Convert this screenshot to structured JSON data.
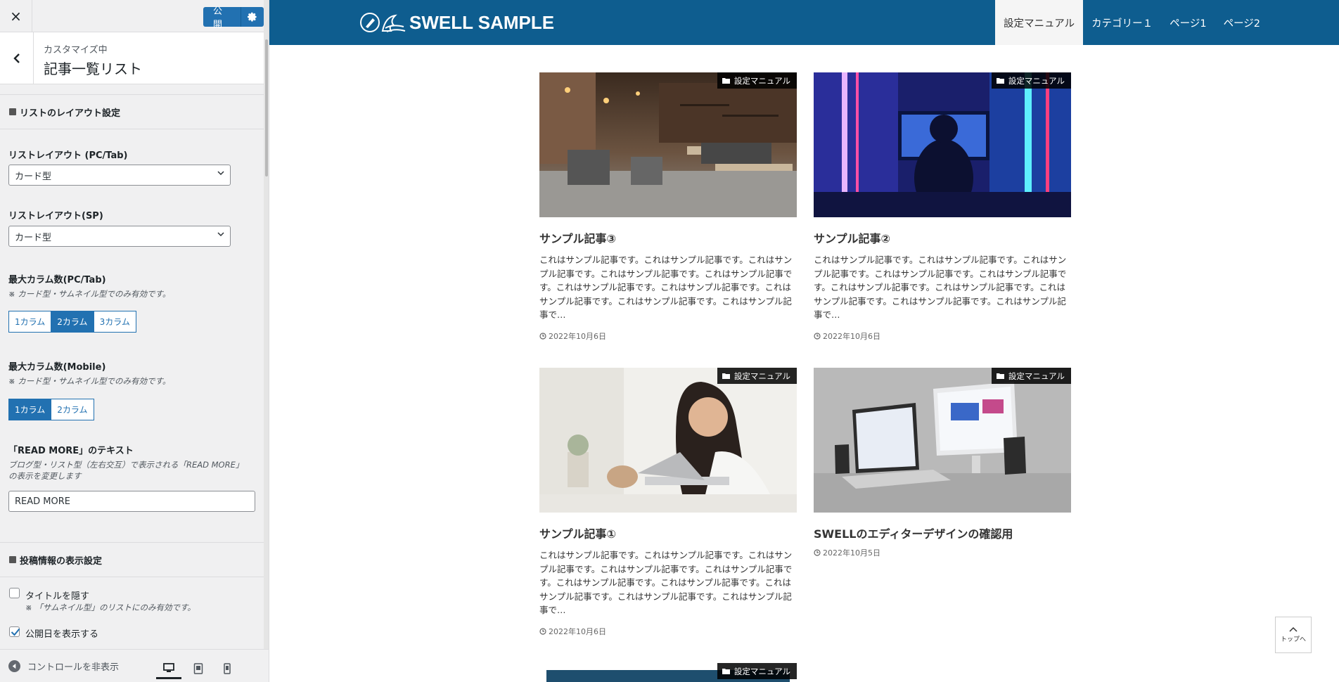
{
  "sidebar": {
    "close_label": "×",
    "publish_label": "公開",
    "header": {
      "sub": "カスタマイズ中",
      "title": "記事一覧リスト"
    },
    "section1_title": "リストのレイアウト設定",
    "layout_pc": {
      "label": "リストレイアウト (PC/Tab)",
      "value": "カード型"
    },
    "layout_sp": {
      "label": "リストレイアウト(SP)",
      "value": "カード型"
    },
    "cols_pc": {
      "label": "最大カラム数(PC/Tab)",
      "note": "※ カード型・サムネイル型でのみ有効です。",
      "options": [
        "1カラム",
        "2カラム",
        "3カラム"
      ],
      "selected": "2カラム"
    },
    "cols_mobile": {
      "label": "最大カラム数(Mobile)",
      "note": "※ カード型・サムネイル型でのみ有効です。",
      "options": [
        "1カラム",
        "2カラム"
      ],
      "selected": "1カラム"
    },
    "readmore": {
      "label": "「READ MORE」のテキスト",
      "note": "ブログ型・リスト型（左右交互）で表示される「READ MORE」の表示を変更します",
      "value": "READ MORE"
    },
    "section2_title": "投稿情報の表示設定",
    "hide_title": {
      "label": "タイトルを隠す",
      "note": "※ 「サムネイル型」のリストにのみ有効です。",
      "checked": false
    },
    "show_date": {
      "label": "公開日を表示する",
      "checked": true
    },
    "footer": {
      "hide_controls": "コントロールを非表示",
      "devices": [
        "desktop-icon",
        "tablet-icon",
        "mobile-icon"
      ],
      "active_device": "desktop"
    }
  },
  "site": {
    "logo_text": "SWELL SAMPLE",
    "nav": [
      "設定マニュアル",
      "カテゴリー１",
      "ページ1",
      "ページ2"
    ],
    "nav_current": "設定マニュアル",
    "brand_color": "#0e5d8f",
    "posts": [
      {
        "category": "設定マニュアル",
        "title": "サンプル記事③",
        "excerpt": "これはサンプル記事です。これはサンプル記事です。これはサンプル記事です。これはサンプル記事です。これはサンプル記事です。これはサンプル記事です。これはサンプル記事です。これはサンプル記事です。これはサンプル記事です。これはサンプル記事で…",
        "date": "2022年10月6日"
      },
      {
        "category": "設定マニュアル",
        "title": "サンプル記事②",
        "excerpt": "これはサンプル記事です。これはサンプル記事です。これはサンプル記事です。これはサンプル記事です。これはサンプル記事です。これはサンプル記事です。これはサンプル記事です。これはサンプル記事です。これはサンプル記事です。これはサンプル記事で…",
        "date": "2022年10月6日"
      },
      {
        "category": "設定マニュアル",
        "title": "サンプル記事①",
        "excerpt": "これはサンプル記事です。これはサンプル記事です。これはサンプル記事です。これはサンプル記事です。これはサンプル記事です。これはサンプル記事です。これはサンプル記事です。これはサンプル記事です。これはサンプル記事です。これはサンプル記事で…",
        "date": "2022年10月6日"
      },
      {
        "category": "設定マニュアル",
        "title": "SWELLのエディターデザインの確認用",
        "excerpt": "",
        "date": "2022年10月5日"
      },
      {
        "category": "設定マニュアル"
      }
    ],
    "totop_label": "トップへ"
  }
}
